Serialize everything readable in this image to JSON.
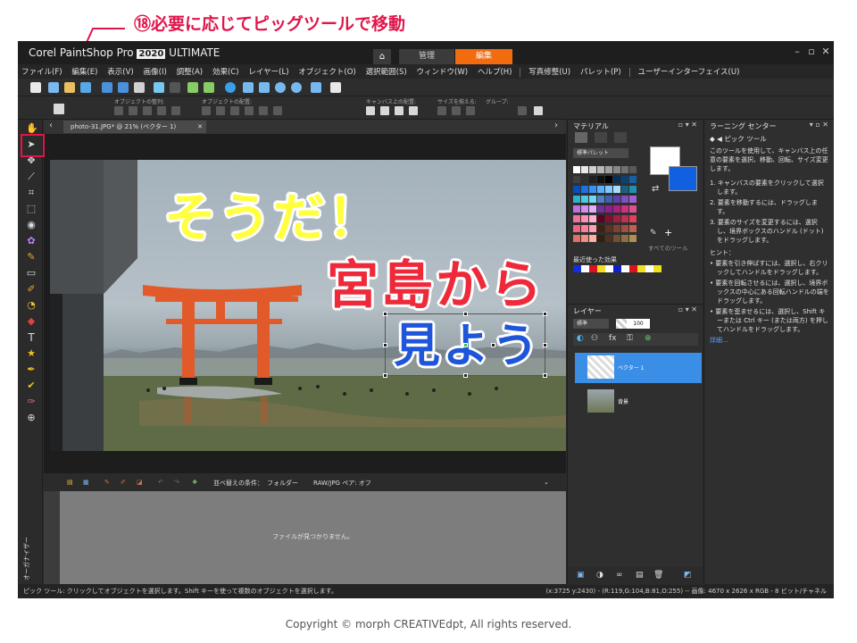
{
  "callout": {
    "text": "⑱必要に応じてピッグツールで移動",
    "color": "#e0154a"
  },
  "titlebar": {
    "brand": "Corel PaintShop Pro",
    "version": "2020",
    "edition": "ULTIMATE",
    "tabs": {
      "manage": "管理",
      "edit": "編集"
    }
  },
  "menu": [
    "ファイル(F)",
    "編集(E)",
    "表示(V)",
    "画像(I)",
    "調整(A)",
    "効果(C)",
    "レイヤー(L)",
    "オブジェクト(O)",
    "選択範囲(S)",
    "ウィンドウ(W)",
    "ヘルプ(H)",
    "写真修整(U)",
    "パレット(P)",
    "ユーザーインターフェイス(U)"
  ],
  "toolbar2": {
    "labels": {
      "arrange": "オブジェクトの整列:",
      "distribute": "オブジェクトの配置:",
      "canvas": "キャンバス上の配置:",
      "size": "サイズを揃える:",
      "group": "グループ:"
    }
  },
  "document": {
    "tab": "photo-31.JPG* @  21% (ベクター 1)",
    "text_top": "そうだ！",
    "text_middle": "宮島から",
    "text_bottom": "見よう"
  },
  "organizer": {
    "sort_label": "並べ替えの条件：",
    "sort_value": "フォルダー",
    "raw_label": "RAW/JPG ペア: オフ",
    "empty": "ファイルが見つかりません。",
    "vertical_label": "オーガナイザー"
  },
  "status": {
    "left": "ピック ツール: クリックしてオブジェクトを選択します。Shift キーを使って複数のオブジェクトを選択します。",
    "right": "(x:3725 y:2430) - (R:119,G:104,B:81,O:255) -- 画像: 4670 x 2626 x RGB - 8 ビット/チャネル"
  },
  "materials": {
    "title": "マテリアル",
    "palette": "標準パレット",
    "recent": "最近使った効果",
    "all_tools": "すべてのツール",
    "recent_colors": [
      "#1030e0",
      "#ffffff",
      "#e01020",
      "#f0e020",
      "#ffffff",
      "#1020d0",
      "#ffffff",
      "#e01020",
      "#f0e020",
      "#ffffff",
      "#f0e020"
    ]
  },
  "layers": {
    "title": "レイヤー",
    "blend": "標準",
    "opacity": "100",
    "layer1": "ベクター 1",
    "layer2": "背景"
  },
  "learning": {
    "title": "ラーニング センター",
    "tool": "ピック ツール",
    "intro": "このツールを使用して、キャンバス上の任意の要素を選択、移動、回転、サイズ変更します。",
    "steps": [
      "1. キャンバスの要素をクリックして選択します。",
      "2. 要素を移動するには、ドラッグします。",
      "3. 要素のサイズを変更するには、選択し、境界ボックスのハンドル (ドット) をドラッグします。"
    ],
    "hint": "ヒント：",
    "hints": [
      "• 要素を引き伸ばすには、選択し、右クリックしてハンドルをドラッグします。",
      "• 要素を回転させるには、選択し、境界ボックスの中心にある回転ハンドルの端をドラッグします。",
      "• 要素を歪ませるには、選択し、Shift キーまたは Ctrl キー (または両方) を押してハンドルをドラッグします。"
    ],
    "more": "詳細..."
  },
  "copyright": "Copyright © morph  CREATIVEdpt, All rights reserved."
}
